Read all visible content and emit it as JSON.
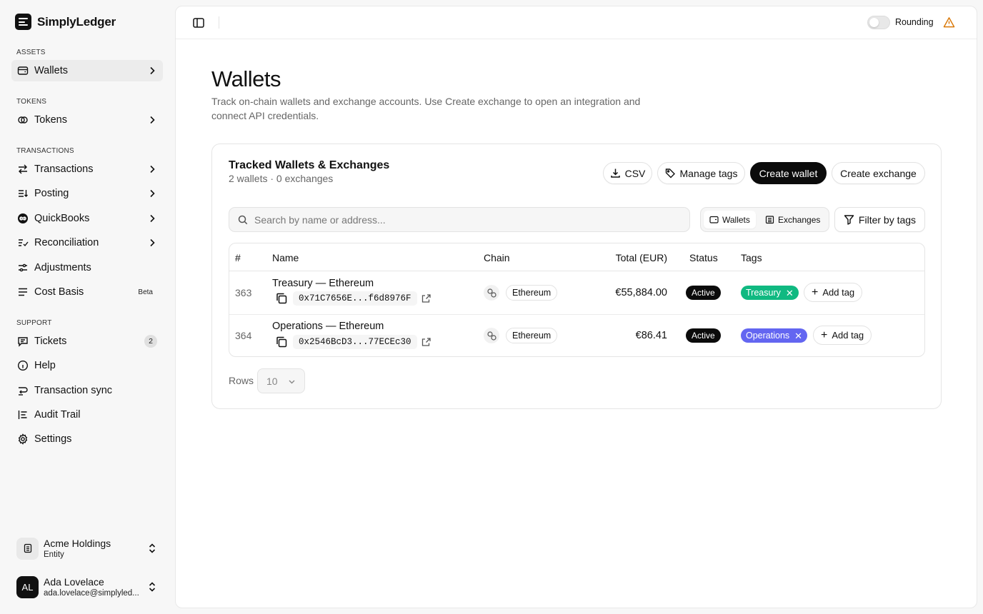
{
  "app": {
    "name": "SimplyLedger"
  },
  "sidebar": {
    "sections": {
      "assets": "ASSETS",
      "tokens": "TOKENS",
      "transactions": "TRANSACTIONS",
      "support": "SUPPORT"
    },
    "items": [
      {
        "label": "Wallets",
        "icon": "wallet-icon"
      },
      {
        "label": "Tokens",
        "icon": "coins-icon"
      },
      {
        "label": "Transactions",
        "icon": "arrows-swap-icon"
      },
      {
        "label": "Posting",
        "icon": "posting-icon"
      },
      {
        "label": "QuickBooks",
        "icon": "quickbooks-icon"
      },
      {
        "label": "Reconciliation",
        "icon": "checklist-icon"
      },
      {
        "label": "Adjustments",
        "icon": "sliders-icon"
      },
      {
        "label": "Cost Basis",
        "icon": "list-icon",
        "badge": "Beta"
      },
      {
        "label": "Tickets",
        "icon": "message-icon",
        "count": "2"
      },
      {
        "label": "Help",
        "icon": "info-icon"
      },
      {
        "label": "Transaction sync",
        "icon": "sync-icon"
      },
      {
        "label": "Audit Trail",
        "icon": "audit-list-icon"
      },
      {
        "label": "Settings",
        "icon": "gear-icon"
      }
    ],
    "entity": {
      "name": "Acme Holdings",
      "sub": "Entity"
    },
    "user": {
      "initials": "AL",
      "name": "Ada Lovelace",
      "email": "ada.lovelace@simplyled..."
    }
  },
  "topbar": {
    "rounding_label": "Rounding",
    "rounding_on": false
  },
  "page": {
    "title": "Wallets",
    "description": "Track on-chain wallets and exchange accounts. Use Create exchange to open an integration and connect API credentials."
  },
  "card": {
    "title": "Tracked Wallets & Exchanges",
    "subtitle": "2 wallets · 0 exchanges",
    "buttons": {
      "csv": "CSV",
      "manage_tags": "Manage tags",
      "create_wallet": "Create wallet",
      "create_exchange": "Create exchange"
    },
    "search": {
      "placeholder": "Search by name or address...",
      "value": ""
    },
    "toggle": {
      "wallets": "Wallets",
      "exchanges": "Exchanges",
      "selected": "Wallets"
    },
    "filter_label": "Filter by tags",
    "table": {
      "columns": [
        "#",
        "Name",
        "Chain",
        "Total (EUR)",
        "Status",
        "Tags"
      ],
      "rows": [
        {
          "id": "363",
          "name": "Treasury — Ethereum",
          "address": "0x71C7656E...f6d8976F",
          "chain": "Ethereum",
          "total": "€55,884.00",
          "status": "Active",
          "tag": "Treasury",
          "tag_color": "#10b981",
          "add_tag": "Add tag"
        },
        {
          "id": "364",
          "name": "Operations — Ethereum",
          "address": "0x2546BcD3...77ECEc30",
          "chain": "Ethereum",
          "total": "€86.41",
          "status": "Active",
          "tag": "Operations",
          "tag_color": "#6366f1",
          "add_tag": "Add tag"
        }
      ]
    },
    "rows_per_page": {
      "label": "Rows",
      "value": "10"
    }
  },
  "colors": {
    "primary": "#0b0b0b",
    "warning": "#d97706"
  }
}
